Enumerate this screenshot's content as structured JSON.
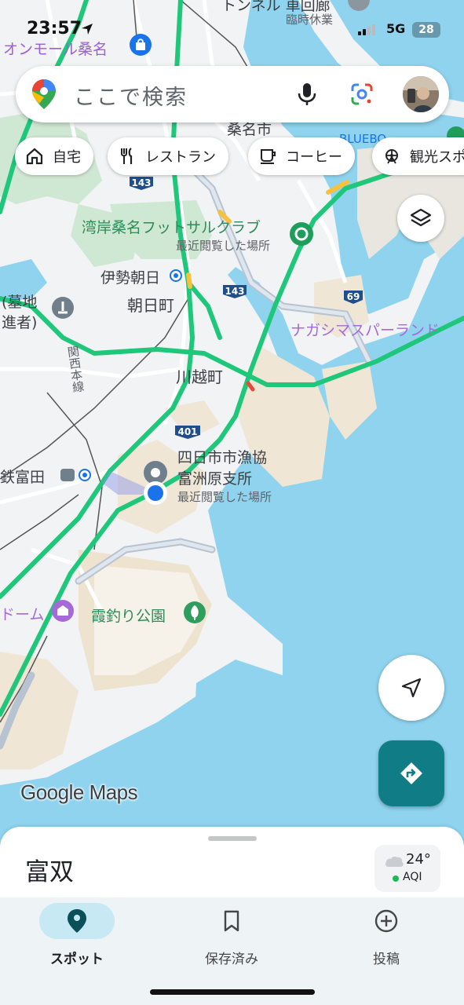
{
  "status_bar": {
    "time": "23:57",
    "network": "5G",
    "battery": "28"
  },
  "search": {
    "placeholder": "ここで検索"
  },
  "chips": [
    {
      "label": "自宅",
      "icon": "home-icon"
    },
    {
      "label": "レストラン",
      "icon": "restaurant-icon"
    },
    {
      "label": "コーヒー",
      "icon": "coffee-icon"
    },
    {
      "label": "観光スポ",
      "icon": "attraction-icon"
    }
  ],
  "map": {
    "labels": {
      "top_tunnel": "トンネル 車回廊",
      "top_closed": "臨時休業",
      "aeon": "オンモール桑名",
      "kuwana_city": "桑名市",
      "bluebo": "BLUEBO",
      "futsal": "湾岸桑名フットサルクラブ",
      "futsal_sub": "最近閲覧した場所",
      "ise_asahi": "伊勢朝日",
      "asahi_town": "朝日町",
      "cemetery_1": "(墓地",
      "cemetery_2": "進者)",
      "nagashima": "ナガシマスパーランド",
      "kansai_line": "関西本線",
      "kawagoe": "川越町",
      "kintetsu_tomida": "鉄富田",
      "fishery_1": "四日市市漁協",
      "fishery_2": "富洲原支所",
      "fishery_sub": "最近閲覧した場所",
      "dome": "ドーム",
      "kasumi_park": "霞釣り公園"
    },
    "road_shields": [
      "143",
      "143",
      "69",
      "401"
    ],
    "attribution": "Google Maps"
  },
  "sheet": {
    "area_name": "富双",
    "weather_temp": "24°",
    "weather_aqi": "AQI"
  },
  "nav": [
    {
      "label": "スポット",
      "active": true
    },
    {
      "label": "保存済み",
      "active": false
    },
    {
      "label": "投稿",
      "active": false
    }
  ],
  "colors": {
    "road_traffic": "#1fc77a",
    "water": "#8fd3ee",
    "accent_teal": "#0f7c86",
    "nav_active_pill": "#c6e9f3",
    "location_dot": "#1a73e8"
  }
}
